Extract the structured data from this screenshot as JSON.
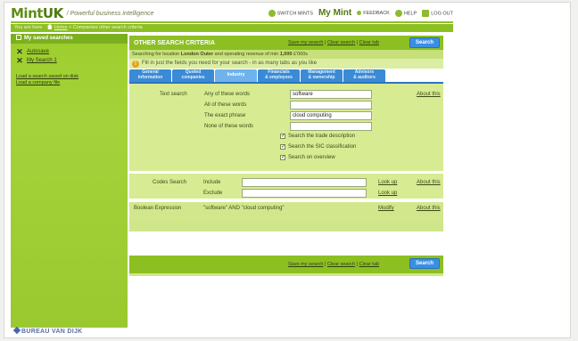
{
  "header": {
    "logo_a": "Mint",
    "logo_b": "UK",
    "tagline": "/ Powerful business intelligence",
    "nav": [
      "SWITCH MINTS",
      "FEEDBACK",
      "HELP",
      "LOG OUT"
    ],
    "mymint_a": "My",
    "mymint_b": "Mint"
  },
  "breadcrumb": {
    "prefix": "You are here",
    "home": "Home",
    "rest": "> Companies other search criteria"
  },
  "sidebar": {
    "title": "My saved searches",
    "items": [
      "Autosave",
      "My Search 1"
    ],
    "links": [
      "Load a search saved on disk",
      "Load a company file"
    ],
    "brand": "BUREAU VAN DIJK"
  },
  "criteria": {
    "title": "OTHER SEARCH CRITERIA",
    "save": "Save my search",
    "clear": "Clear search",
    "clear_tab": "Clear tab",
    "search": "Search",
    "info_a": "Searching for location",
    "info_loc": "London Outer",
    "info_b": "and operating revenue of min",
    "info_val": "1,000",
    "info_unit": "£'000s",
    "note": "Fill in just the fields you need for your search - in as many tabs as you like"
  },
  "tabs": [
    {
      "l1": "General",
      "l2": "information"
    },
    {
      "l1": "Quoted",
      "l2": "companies"
    },
    {
      "l1": "Industry",
      "l2": ""
    },
    {
      "l1": "Financials",
      "l2": "& employees"
    },
    {
      "l1": "Management",
      "l2": "& ownership"
    },
    {
      "l1": "Advisors",
      "l2": "& auditors"
    }
  ],
  "text_search": {
    "label": "Text search",
    "about": "About this",
    "rows": [
      "Any of these words",
      "All of these words",
      "The exact phrase",
      "None of these words"
    ],
    "values": [
      "software",
      "",
      "cloud computing",
      ""
    ],
    "checks": [
      "Search the trade description",
      "Search the SIC classification",
      "Search on overview"
    ]
  },
  "codes": {
    "label": "Codes Search",
    "include": "Include",
    "exclude": "Exclude",
    "lookup": "Look up",
    "about": "About this"
  },
  "boolean": {
    "label": "Boolean Expression",
    "expr": "\"software\" AND \"cloud computing\"",
    "modify": "Modify",
    "about": "About this"
  }
}
